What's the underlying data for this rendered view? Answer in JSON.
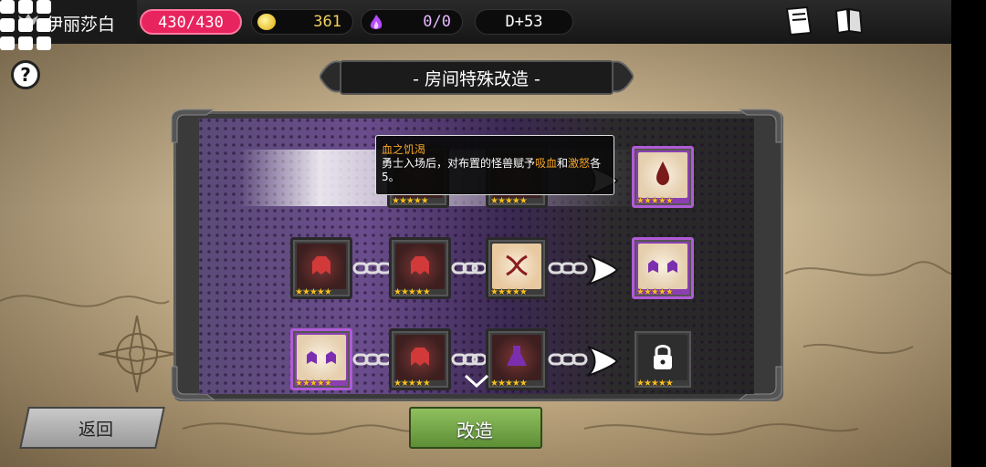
{
  "player": {
    "name": "伊丽莎白"
  },
  "resources": {
    "hp": "430/430",
    "gold": "361",
    "souls": "0/0",
    "day": "D+53"
  },
  "header_icons": [
    "book-icon",
    "book-open-icon",
    "grid-menu-icon"
  ],
  "help": {
    "label": "?"
  },
  "title": "- 房间特殊改造 -",
  "tooltip": {
    "title": "血之饥渴",
    "body_prefix": "勇士入场后，对布置的怪兽赋予",
    "keyword1": "吸血",
    "connector": "和",
    "keyword2": "激怒",
    "body_suffix": "各5。"
  },
  "rows": [
    {
      "slots": [
        {
          "kind": "dark",
          "icon": "flame-icon",
          "stars": "★★★★★"
        },
        {
          "kind": "dark",
          "icon": "goblet-icon",
          "stars": "★★★★★"
        },
        {
          "kind": "purple",
          "icon": "blood-drop-icon",
          "stars": "★★★★★"
        }
      ]
    },
    {
      "slots": [
        {
          "kind": "dark",
          "icon": "monster-icon",
          "stars": "★★★★★"
        },
        {
          "kind": "dark",
          "icon": "monster-icon",
          "stars": "★★★★★"
        },
        {
          "kind": "bright",
          "icon": "dna-icon",
          "stars": "★★★★★"
        },
        {
          "kind": "purple",
          "icon": "twin-monster-icon",
          "stars": "★★★★★"
        }
      ]
    },
    {
      "slots": [
        {
          "kind": "purple",
          "icon": "twin-monster-icon",
          "stars": "★★★★★"
        },
        {
          "kind": "dark",
          "icon": "monster-icon",
          "stars": "★★★★★"
        },
        {
          "kind": "dark",
          "icon": "alchemy-icon",
          "stars": "★★★★★"
        },
        {
          "kind": "lock",
          "icon": "lock-icon",
          "stars": "★★★★★"
        }
      ]
    }
  ],
  "buttons": {
    "back": "返回",
    "modify": "改造"
  },
  "colors": {
    "hp": "#e8245e",
    "gold": "#f0d060",
    "highlight": "#f5a623",
    "confirm": "#6fa545"
  }
}
